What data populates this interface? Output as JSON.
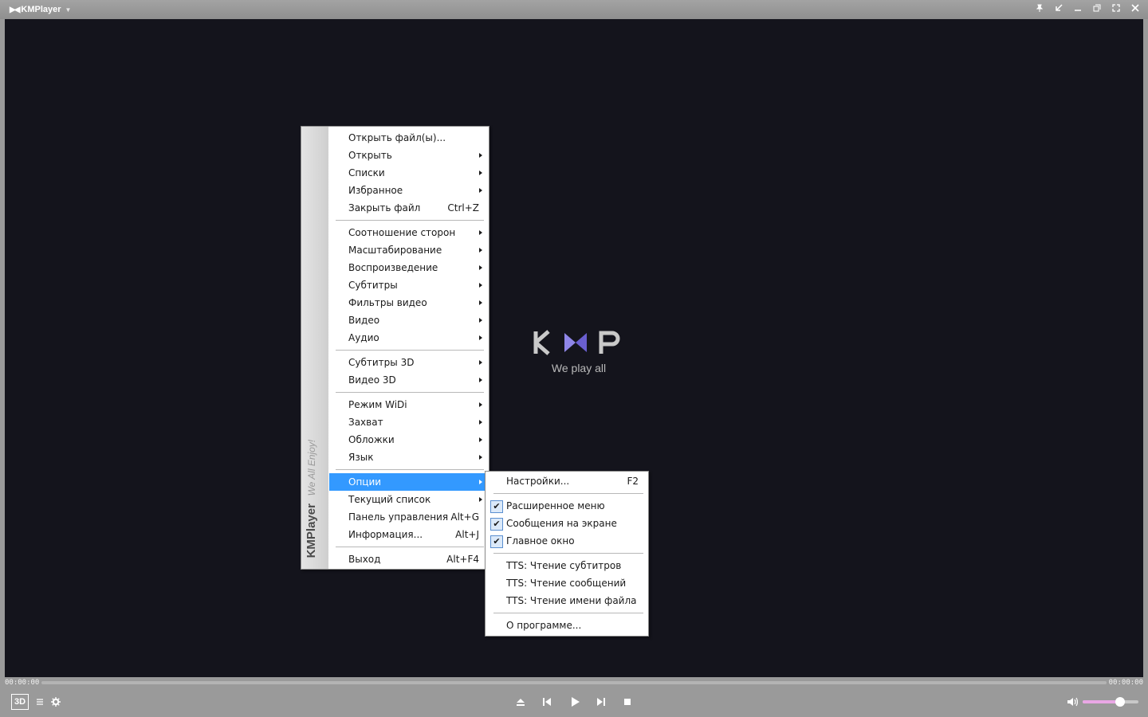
{
  "titlebar": {
    "app_name": "KMPlayer",
    "buttons": {
      "pin": "pin-icon",
      "restore_down": "restore-down-icon",
      "minimize": "minimize-icon",
      "window_mode": "window-mode-icon",
      "fullscreen": "fullscreen-icon",
      "close": "close-icon"
    }
  },
  "player": {
    "logo_text": "KMP",
    "tagline": "We play all",
    "time_elapsed": "00:00:00",
    "time_total": "00:00:00",
    "volume_level": 0.67,
    "btn_3d": "3D"
  },
  "main_menu": {
    "brand": "KMPlayer",
    "slogan": "We All Enjoy!",
    "items": [
      {
        "label": "Открыть файл(ы)...",
        "shortcut": "",
        "submenu": false
      },
      {
        "label": "Открыть",
        "shortcut": "",
        "submenu": true
      },
      {
        "label": "Списки",
        "shortcut": "",
        "submenu": true
      },
      {
        "label": "Избранное",
        "shortcut": "",
        "submenu": true
      },
      {
        "label": "Закрыть файл",
        "shortcut": "Ctrl+Z",
        "submenu": false
      },
      {
        "label": "Соотношение сторон",
        "shortcut": "",
        "submenu": true
      },
      {
        "label": "Масштабирование",
        "shortcut": "",
        "submenu": true
      },
      {
        "label": "Воспроизведение",
        "shortcut": "",
        "submenu": true
      },
      {
        "label": "Субтитры",
        "shortcut": "",
        "submenu": true
      },
      {
        "label": "Фильтры видео",
        "shortcut": "",
        "submenu": true
      },
      {
        "label": "Видео",
        "shortcut": "",
        "submenu": true
      },
      {
        "label": "Аудио",
        "shortcut": "",
        "submenu": true
      },
      {
        "label": "Субтитры 3D",
        "shortcut": "",
        "submenu": true
      },
      {
        "label": "Видео 3D",
        "shortcut": "",
        "submenu": true
      },
      {
        "label": "Режим WiDi",
        "shortcut": "",
        "submenu": true
      },
      {
        "label": "Захват",
        "shortcut": "",
        "submenu": true
      },
      {
        "label": "Обложки",
        "shortcut": "",
        "submenu": true
      },
      {
        "label": "Язык",
        "shortcut": "",
        "submenu": true
      },
      {
        "label": "Опции",
        "shortcut": "",
        "submenu": true,
        "active": true
      },
      {
        "label": "Текущий список",
        "shortcut": "",
        "submenu": true
      },
      {
        "label": "Панель управления",
        "shortcut": "Alt+G",
        "submenu": false
      },
      {
        "label": "Информация...",
        "shortcut": "Alt+J",
        "submenu": false
      },
      {
        "label": "Выход",
        "shortcut": "Alt+F4",
        "submenu": false
      }
    ]
  },
  "options_menu": {
    "items": [
      {
        "label": "Настройки...",
        "shortcut": "F2",
        "checked": false
      },
      {
        "label": "Расширенное меню",
        "shortcut": "",
        "checked": true
      },
      {
        "label": "Сообщения на экране",
        "shortcut": "",
        "checked": true
      },
      {
        "label": "Главное окно",
        "shortcut": "",
        "checked": true
      },
      {
        "label": "TTS: Чтение субтитров",
        "shortcut": "",
        "checked": false
      },
      {
        "label": "TTS: Чтение сообщений",
        "shortcut": "",
        "checked": false
      },
      {
        "label": "TTS: Чтение имени файла",
        "shortcut": "",
        "checked": false
      },
      {
        "label": "О программе...",
        "shortcut": "",
        "checked": false
      }
    ]
  }
}
